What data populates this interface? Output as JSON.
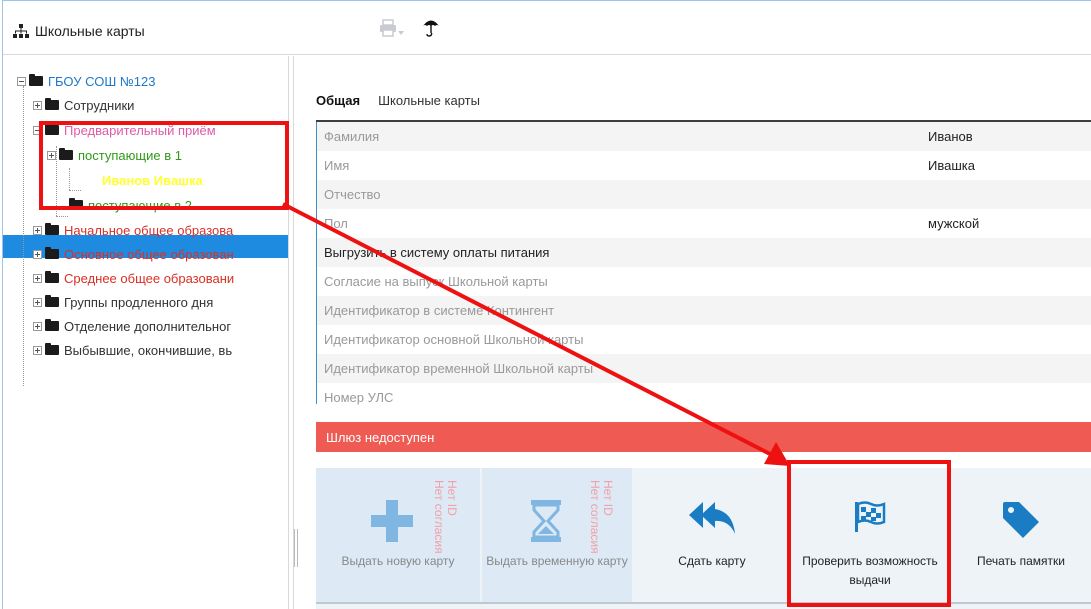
{
  "app": {
    "title": "Школьные карты",
    "toolbar": {
      "print_icon": "printer-icon",
      "umbrella_icon": "umbrella-icon"
    }
  },
  "tree": {
    "root": "ГБОУ СОШ №123",
    "items": [
      {
        "label": "Сотрудники"
      },
      {
        "label": "Предварительный приём"
      },
      {
        "label": "поступающие в 1"
      },
      {
        "label": "Иванов Ивашка"
      },
      {
        "label": "поступающие в 2"
      },
      {
        "label": "Начальное общее образова"
      },
      {
        "label": "Основное общее образован"
      },
      {
        "label": "Среднее общее образовани"
      },
      {
        "label": "Группы продленного дня"
      },
      {
        "label": "Отделение дополнительног"
      },
      {
        "label": "Выбывшие, окончившие, вь"
      }
    ]
  },
  "tabs": [
    {
      "label": "Общая"
    },
    {
      "label": "Школьные карты"
    }
  ],
  "properties": [
    {
      "label": "Фамилия",
      "value": "Иванов"
    },
    {
      "label": "Имя",
      "value": "Ивашка"
    },
    {
      "label": "Отчество",
      "value": ""
    },
    {
      "label": "Пол",
      "value": "мужской"
    },
    {
      "label": "Выгрузить в систему оплаты питания",
      "value": ""
    },
    {
      "label": "Согласие на выпуск Школьной карты",
      "value": ""
    },
    {
      "label": "Идентификатор в системе Контингент",
      "value": ""
    },
    {
      "label": "Идентификатор основной Школьной карты",
      "value": ""
    },
    {
      "label": "Идентификатор временной Школьной карты",
      "value": ""
    },
    {
      "label": "Номер УЛС",
      "value": ""
    }
  ],
  "banner": "Шлюз недоступен",
  "actions": [
    {
      "label": "Выдать новую карту",
      "note1": "Нет ID",
      "note2": "Нет согласия"
    },
    {
      "label": "Выдать временную карту",
      "note1": "Нет ID",
      "note2": "Нет согласия"
    },
    {
      "label": "Сдать карту"
    },
    {
      "label": "Проверить возможность выдачи"
    },
    {
      "label": "Печать памятки"
    }
  ],
  "colors": {
    "accent": "#1e8ae0",
    "banner": "#ef5a52",
    "highlight": "#ee1111",
    "icon": "#1a7dc4"
  }
}
